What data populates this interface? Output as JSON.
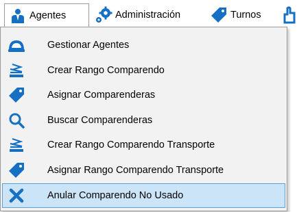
{
  "menubar": {
    "items": [
      {
        "label": "Agentes",
        "icon": "agent-icon"
      },
      {
        "label": "Administración",
        "icon": "gears-icon"
      },
      {
        "label": "Turnos",
        "icon": "tag-icon"
      }
    ]
  },
  "dropdown": {
    "items": [
      {
        "label": "Gestionar Agentes",
        "icon": "cap-icon"
      },
      {
        "label": "Crear Rango Comparendo",
        "icon": "stack-arrow-icon"
      },
      {
        "label": "Asignar Comparenderas",
        "icon": "tag-icon"
      },
      {
        "label": "Buscar Comparenderas",
        "icon": "search-icon"
      },
      {
        "label": "Crear Rango Comparendo Transporte",
        "icon": "stack-arrow-icon"
      },
      {
        "label": "Asignar Rango Comparendo Transporte",
        "icon": "tag-icon"
      },
      {
        "label": "Anular Comparendo No Usado",
        "icon": "close-icon",
        "selected": true
      }
    ]
  },
  "colors": {
    "icon_blue": "#1570c4",
    "selection_bg": "#cce4f7",
    "selection_border": "#5a9fd8",
    "dropdown_bg": "#f2f2f2"
  }
}
